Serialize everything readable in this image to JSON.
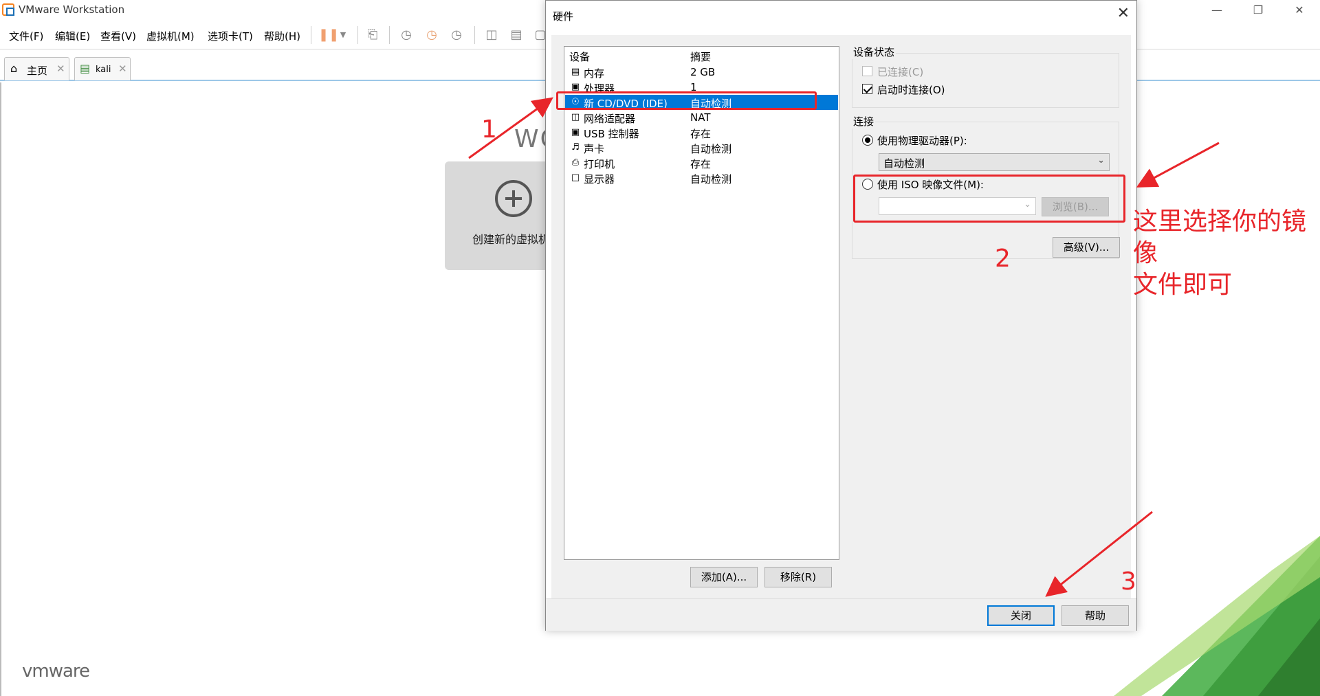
{
  "window": {
    "title": "VMware Workstation",
    "minimize_icon": "minimize-icon",
    "restore_icon": "restore-icon",
    "close_icon": "close-icon"
  },
  "menu": {
    "items": [
      "文件(F)",
      "编辑(E)",
      "查看(V)",
      "虚拟机(M)",
      "选项卡(T)",
      "帮助(H)"
    ]
  },
  "tabs": [
    {
      "label": "主页",
      "icon": "home-icon"
    },
    {
      "label": "kali",
      "icon": "vm-icon"
    }
  ],
  "home": {
    "welcome_fragment": "WO",
    "create_label": "创建新的虚拟机",
    "logo": "vmware"
  },
  "dialog": {
    "title": "硬件",
    "devices": {
      "header_device": "设备",
      "header_summary": "摘要",
      "rows": [
        {
          "name": "内存",
          "summary": "2 GB",
          "icon": "memory-icon"
        },
        {
          "name": "处理器",
          "summary": "1",
          "icon": "processor-icon"
        },
        {
          "name": "新 CD/DVD (IDE)",
          "summary": "自动检测",
          "icon": "cd-dvd-icon",
          "selected": true
        },
        {
          "name": "网络适配器",
          "summary": "NAT",
          "icon": "network-icon"
        },
        {
          "name": "USB 控制器",
          "summary": "存在",
          "icon": "usb-icon"
        },
        {
          "name": "声卡",
          "summary": "自动检测",
          "icon": "sound-icon"
        },
        {
          "name": "打印机",
          "summary": "存在",
          "icon": "printer-icon"
        },
        {
          "name": "显示器",
          "summary": "自动检测",
          "icon": "display-icon"
        }
      ]
    },
    "add_button": "添加(A)...",
    "remove_button": "移除(R)",
    "status": {
      "label": "设备状态",
      "connected": "已连接(C)",
      "connect_on_start": "启动时连接(O)"
    },
    "connection": {
      "label": "连接",
      "physical": "使用物理驱动器(P):",
      "physical_value": "自动检测",
      "iso": "使用 ISO 映像文件(M):",
      "iso_value": "",
      "browse": "浏览(B)..."
    },
    "advanced_button": "高级(V)...",
    "close_button": "关闭",
    "help_button": "帮助"
  },
  "annotations": {
    "step1": "1",
    "step2": "2",
    "step3": "3",
    "note_line1": "这里选择你的镜像",
    "note_line2": "文件即可",
    "color": "#e8252a"
  }
}
